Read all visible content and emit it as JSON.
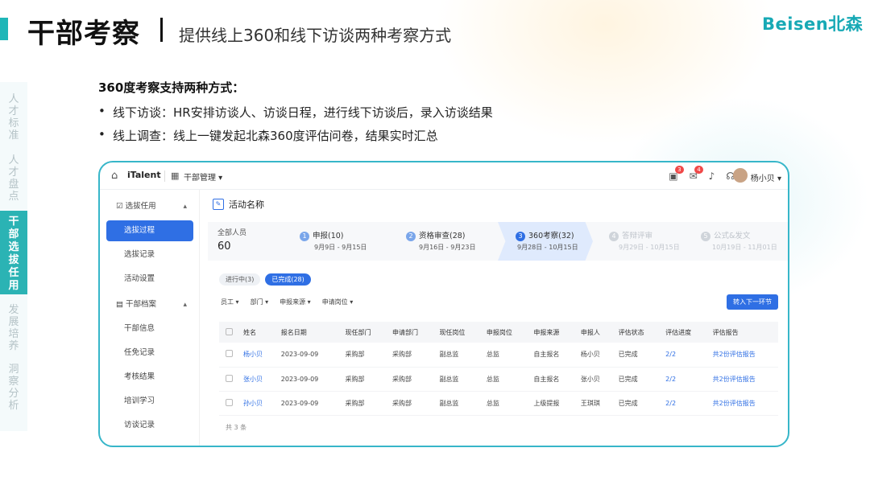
{
  "slide": {
    "title": "干部考察",
    "subtitle": "提供线上360和线下访谈两种考察方式",
    "brand": "Beisen北森"
  },
  "side_nav": [
    {
      "label": "人才标准",
      "active": false
    },
    {
      "label": "人才盘点",
      "active": false
    },
    {
      "label": "干部选拔任用",
      "active": true
    },
    {
      "label": "发展培养",
      "active": false
    },
    {
      "label": "洞察分析",
      "active": false
    }
  ],
  "intro": {
    "heading": "360度考察支持两种方式：",
    "bullets": [
      "线下访谈：HR安排访谈人、访谈日程，进行线下访谈后，录入访谈结果",
      "线上调查：线上一键发起北森360度评估问卷，结果实时汇总"
    ]
  },
  "app": {
    "logo": "iTalent",
    "menu": "干部管理",
    "badges": [
      "3",
      "4"
    ],
    "user": "杨小贝",
    "left_menu": {
      "group1": "选拔任用",
      "items1": [
        "选拔过程",
        "选拔记录",
        "活动设置"
      ],
      "group2": "干部档案",
      "items2": [
        "干部信息",
        "任免记录",
        "考核结果",
        "培训学习",
        "访谈记录"
      ]
    },
    "activity_title": "活动名称",
    "total_label": "全部人员",
    "total_value": "60",
    "steps": [
      {
        "num": "1",
        "label": "申报(10)",
        "date": "9月9日 - 9月15日"
      },
      {
        "num": "2",
        "label": "资格审查(28)",
        "date": "9月16日 - 9月23日"
      },
      {
        "num": "3",
        "label": "360考察(32)",
        "date": "9月28日 - 10月15日"
      },
      {
        "num": "4",
        "label": "答辩评审",
        "date": "9月29日 - 10月15日"
      },
      {
        "num": "5",
        "label": "公式&发文",
        "date": "10月19日 - 11月01日"
      }
    ],
    "pills": [
      "进行中(3)",
      "已完成(28)"
    ],
    "filters": [
      "员工",
      "部门",
      "申报来源",
      "申请岗位"
    ],
    "next_button": "转入下一环节",
    "table": {
      "headers": [
        "姓名",
        "报名日期",
        "现任部门",
        "申请部门",
        "现任岗位",
        "申报岗位",
        "申报来源",
        "申报人",
        "评估状态",
        "评估进度",
        "评估报告"
      ],
      "rows": [
        [
          "杨小贝",
          "2023-09-09",
          "采购部",
          "采购部",
          "副总监",
          "总监",
          "自主报名",
          "杨小贝",
          "已完成",
          "2/2",
          "共2份评估报告"
        ],
        [
          "张小贝",
          "2023-09-09",
          "采购部",
          "采购部",
          "副总监",
          "总监",
          "自主报名",
          "张小贝",
          "已完成",
          "2/2",
          "共2份评估报告"
        ],
        [
          "孙小贝",
          "2023-09-09",
          "采购部",
          "采购部",
          "副总监",
          "总监",
          "上级提报",
          "王琪琪",
          "已完成",
          "2/2",
          "共2份评估报告"
        ]
      ]
    },
    "record_count": "共 3 条"
  }
}
